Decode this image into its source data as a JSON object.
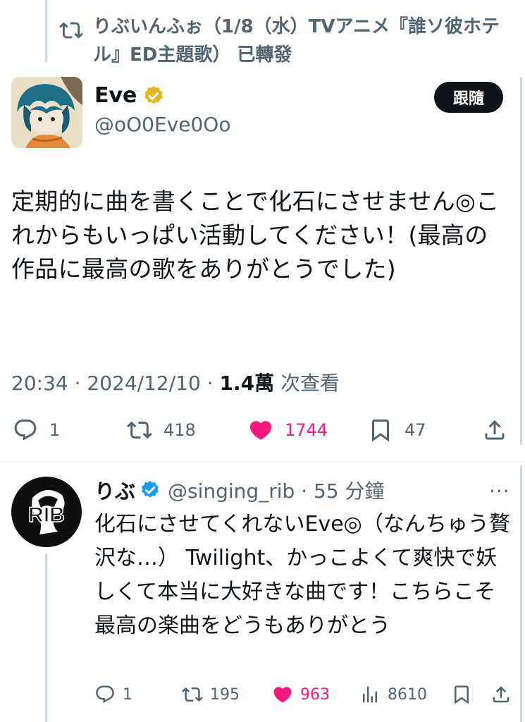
{
  "retweet_header": {
    "text": "りぶいんふぉ（1/8（水）TVアニメ『誰ソ彼ホテル』ED主題歌） 已轉發"
  },
  "main_tweet": {
    "display_name": "Eve",
    "handle": "@oO0Eve0Oo",
    "follow_label": "跟隨",
    "text": "定期的に曲を書くことで化石にさせません◎これからもいっぱい活動してください！(最高の作品に最高の歌をありがとうでした)",
    "time": "20:34 · 2024/12/10 · ",
    "views_count": "1.4萬",
    "views_label": " 次查看",
    "actions": {
      "replies": "1",
      "retweets": "418",
      "likes": "1744",
      "bookmarks": "47"
    }
  },
  "reply_tweet": {
    "display_name": "りぶ",
    "handle_time": "@singing_rib · 55 分鐘",
    "avatar_text": "RIB",
    "more_label": "···",
    "text": "化石にさせてくれないEve◎（なんちゅう贅沢な…） Twilight、かっこよくて爽快で妖しくて本当に大好きな曲です！こちらこそ最高の楽曲をどうもありがとう",
    "actions": {
      "replies": "1",
      "retweets": "195",
      "likes": "963",
      "views": "8610"
    }
  },
  "colors": {
    "verified_gold": "#e2b719",
    "verified_blue": "#1d9bf0",
    "like_pink": "#f91880",
    "muted": "#536471"
  },
  "icons": [
    "retweet-icon",
    "verified-gold-icon",
    "verified-blue-icon",
    "reply-icon",
    "heart-icon",
    "bookmark-icon",
    "share-icon",
    "views-icon",
    "more-icon"
  ]
}
